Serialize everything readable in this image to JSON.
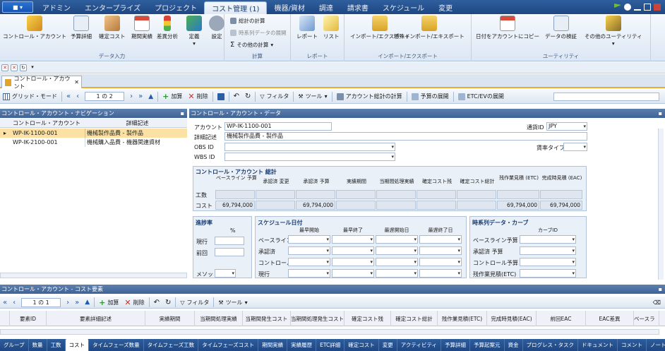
{
  "menu": {
    "app_button": "",
    "tabs": [
      "アドミン",
      "エンタープライズ",
      "プロジェクト",
      "コスト管理 (1)",
      "機器/資材",
      "調達",
      "請求書",
      "スケジュール",
      "変更"
    ],
    "active_tab": 3
  },
  "ribbon": {
    "groups": [
      {
        "label": "データ入力",
        "buttons": [
          "コントロール・アカウント",
          "予算詳細",
          "確定コスト",
          "期間実績",
          "差異分析",
          "定義",
          "設定"
        ]
      },
      {
        "label": "計算",
        "items": [
          "総計の計算",
          "時系列データの展開",
          "その他の計算"
        ]
      },
      {
        "label": "レポート",
        "buttons": [
          "レポート",
          "リスト"
        ]
      },
      {
        "label": "インポート/エクスポート",
        "buttons": [
          "インポート/エクスポート",
          "特殊インポート/エキスポート"
        ]
      },
      {
        "label": "ユーティリティ",
        "buttons": [
          "日付をアカウントにコピー",
          "データの検証",
          "その他のユーティリティ"
        ]
      }
    ]
  },
  "doc_tab": "コントロール・アカウント",
  "toolbar": {
    "grid_mode": "グリッド・モード",
    "pager": "1 の 2",
    "add": "加算",
    "delete": "削除",
    "filter": "フィルタ",
    "tools": "ツール",
    "account_total": "アカウント総計の計算",
    "budget_expand": "予算の展開",
    "etc_expand": "ETC/EVの展開"
  },
  "nav": {
    "title": "コントロール・アカウント・ナビゲーション",
    "col_id": "コントロール・アカウント ID",
    "col_desc": "詳細記述",
    "rows": [
      {
        "id": "WP-IK-1100-001",
        "desc": "機械製作品費 - 製作品"
      },
      {
        "id": "WP-IK-2100-001",
        "desc": "機械購入品費 - 機器関連資材"
      }
    ]
  },
  "data_panel": {
    "title": "コントロール・アカウント・データ",
    "account_id_label": "アカウント ID",
    "account_id": "WP-IK-1100-001",
    "currency_label": "通貨ID",
    "currency": "JPY",
    "desc_label": "詳細記述",
    "desc": "機械製作品費 - 製作品",
    "obs_label": "OBS ID",
    "wbs_label": "WBS ID",
    "rate_label": "賃率タイプ",
    "summary_title": "コントロール・アカウント 総計",
    "summary_cols": [
      "ベースライン 予算",
      "承認済 変更",
      "承認済 予算",
      "実績期間",
      "当期間処理実績",
      "確定コスト残",
      "確定コスト総計",
      "残作業見積 (ETC)",
      "完成時見積 (EAC)"
    ],
    "row_hours": "工数",
    "row_cost": "コスト",
    "cost_values": [
      "69,794,000",
      "",
      "69,794,000",
      "",
      "",
      "",
      "",
      "69,794,000",
      "69,794,000"
    ],
    "progress_title": "進捗率",
    "progress_unit": "%",
    "progress_rows": [
      "現行",
      "前回"
    ],
    "method_label": "メソッド",
    "schedule_title": "スケジュール日付",
    "schedule_cols": [
      "最早開始",
      "最早終了",
      "最遅開始日",
      "最遅終了日"
    ],
    "schedule_rows": [
      "ベースライン",
      "承認済",
      "コントロール",
      "現行"
    ],
    "ts_title": "時系列データ・カーブ",
    "ts_col": "カーブID",
    "ts_rows": [
      "ベースライン予算",
      "承認済 予算",
      "コントロール予算",
      "残作業見積(ETC)"
    ]
  },
  "elements": {
    "title": "コントロール・アカウント - コスト要素",
    "pager": "1 の 1",
    "add": "加算",
    "delete": "削除",
    "filter": "フィルタ",
    "tools": "ツール",
    "cols": [
      "要素ID",
      "要素詳細記述",
      "実績期間",
      "当期間処理実績",
      "当期間発生コスト",
      "当期間処理発生コスト",
      "確定コスト残",
      "確定コスト総計",
      "残作業見積(ETC)",
      "完成時見積(EAC)",
      "前回EAC",
      "EAC差異",
      "ベースラ"
    ]
  },
  "bottom_tabs": [
    "グループ",
    "数量",
    "工数",
    "コスト",
    "タイムフェーズ数量",
    "タイムフェーズ工数",
    "タイムフェーズコスト",
    "期間実績",
    "実績履歴",
    "ETC詳細",
    "確定コスト",
    "変更",
    "アクティビティ",
    "予算詳細",
    "予算起案元",
    "資金",
    "プログレス・タスク",
    "ドキュメント",
    "コメント",
    "ノート"
  ],
  "active_bottom_tab": 3,
  "colors": {
    "accent": "#1e4683",
    "selected_row": "#fbe2a4",
    "doc_tab_line": "#f0a830"
  }
}
